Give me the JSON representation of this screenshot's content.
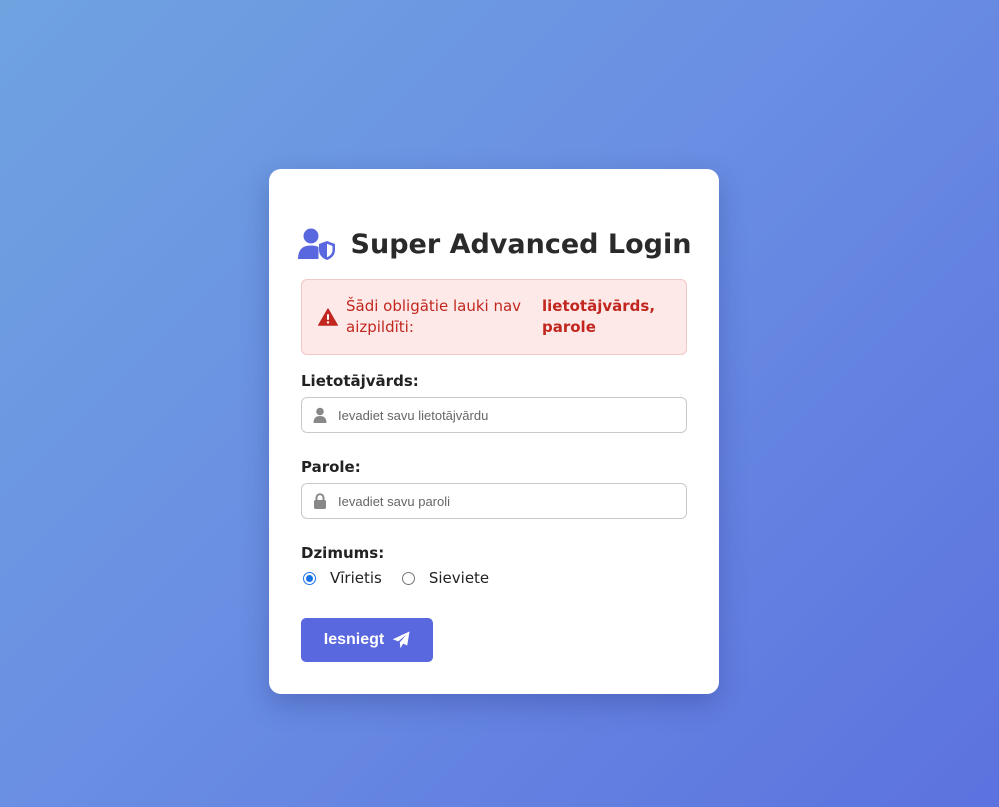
{
  "title": "Super Advanced Login",
  "icons": {
    "title": "user-shield-icon",
    "alert": "warning-triangle-icon",
    "username": "user-icon",
    "password": "lock-icon",
    "submit": "paper-plane-icon"
  },
  "alert": {
    "message": "Šādi obligātie lauki nav aizpildīti:",
    "fields": "lietotājvārds, parole"
  },
  "username": {
    "label": "Lietotājvārds:",
    "placeholder": "Ievadiet savu lietotājvārdu",
    "value": ""
  },
  "password": {
    "label": "Parole:",
    "placeholder": "Ievadiet savu paroli",
    "value": ""
  },
  "gender": {
    "label": "Dzimums:",
    "options": [
      {
        "label": "Vīrietis",
        "checked": true
      },
      {
        "label": "Sieviete",
        "checked": false
      }
    ]
  },
  "submit_label": "Iesniegt",
  "colors": {
    "accent": "#5a68df",
    "error_text": "#c1271f",
    "error_bg": "#fde9e8"
  }
}
